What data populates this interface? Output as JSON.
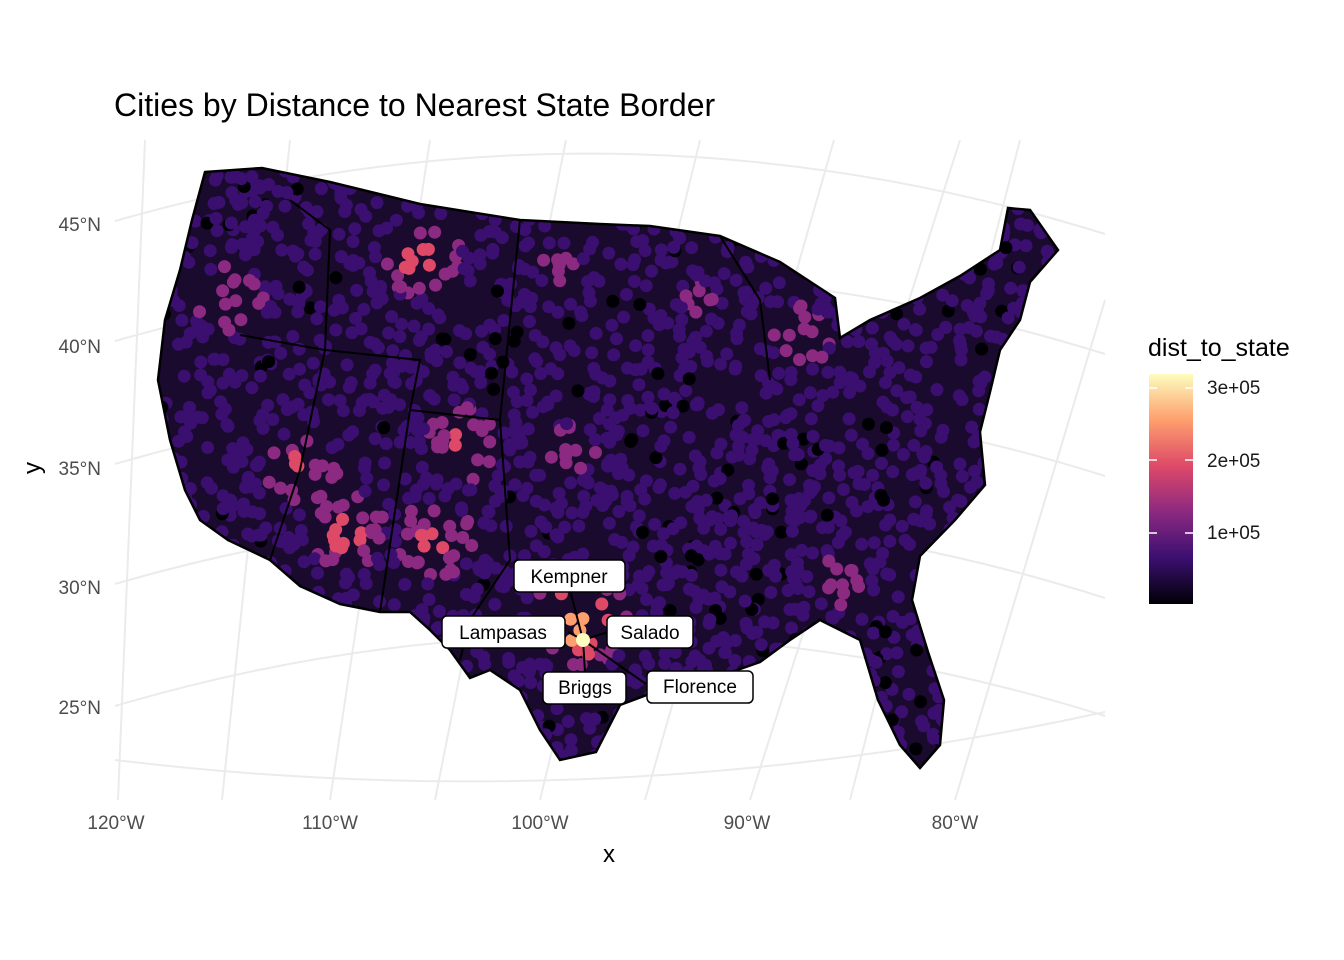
{
  "chart_data": {
    "type": "map",
    "title": "Cities by Distance to Nearest State Border",
    "xlabel": "x",
    "ylabel": "y",
    "lon_ticks": [
      "120°W",
      "110°W",
      "100°W",
      "90°W",
      "80°W"
    ],
    "lat_ticks": [
      "45°N",
      "40°N",
      "35°N",
      "30°N",
      "25°N"
    ],
    "legend": {
      "title": "dist_to_state",
      "breaks": [
        "3e+05",
        "2e+05",
        "1e+05"
      ],
      "break_values": [
        300000,
        200000,
        100000
      ],
      "range": [
        0,
        320000
      ],
      "colors": [
        "#000004",
        "#3b0f70",
        "#8c2981",
        "#de4968",
        "#fe9f6d",
        "#fcfdbf"
      ],
      "placement": "right"
    },
    "labels": [
      "Kempner",
      "Lampasas",
      "Salado",
      "Briggs",
      "Florence"
    ],
    "grid": true
  }
}
